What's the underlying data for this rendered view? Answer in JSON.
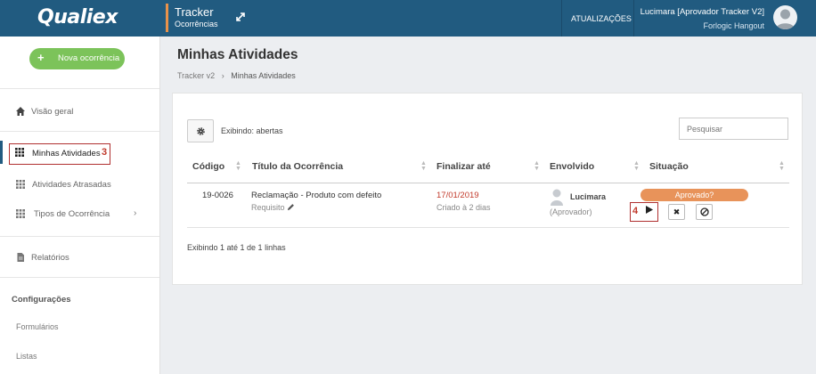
{
  "header": {
    "logo": "Qualiex",
    "module_title": "Tracker",
    "module_subtitle": "Ocorrências",
    "updates_label": "ATUALIZAÇÕES",
    "user_name": "Lucimara [Aprovador Tracker V2]",
    "user_company": "Forlogic Hangout"
  },
  "sidebar": {
    "new_button": "Nova ocorrência",
    "items": [
      {
        "label": "Visão geral",
        "icon": "home-icon"
      },
      {
        "label": "Minhas Atividades",
        "icon": "grid-icon"
      },
      {
        "label": "Atividades Atrasadas",
        "icon": "grid-icon"
      },
      {
        "label": "Tipos de Ocorrência",
        "icon": "grid-icon"
      },
      {
        "label": "Relatórios",
        "icon": "document-icon"
      }
    ],
    "annotation_3": "3",
    "config_title": "Configurações",
    "config_links": [
      "Formulários",
      "Listas"
    ]
  },
  "page": {
    "title": "Minhas Atividades",
    "breadcrumb": [
      "Tracker v2",
      "Minhas Atividades"
    ],
    "showing_label": "Exibindo: abertas",
    "search_placeholder": "Pesquisar",
    "columns": [
      "Código",
      "Título da Ocorrência",
      "Finalizar até",
      "Envolvido",
      "Situação"
    ],
    "rows": [
      {
        "code": "19-0026",
        "title": "Reclamação - Produto com defeito",
        "subtitle": "Requisito",
        "due_date": "17/01/2019",
        "created": "Criado à 2 dias",
        "person": "Lucimara",
        "role": "(Aprovador)",
        "status": "Aprovado?"
      }
    ],
    "annotation_4": "4",
    "footer": "Exibindo 1 até 1 de 1 linhas"
  },
  "colors": {
    "topbar": "#215b80",
    "accent": "#e8924a",
    "new_button": "#7cc35a",
    "status": "#e8935a",
    "due_date": "#c23a2b",
    "highlight": "#b03030"
  }
}
